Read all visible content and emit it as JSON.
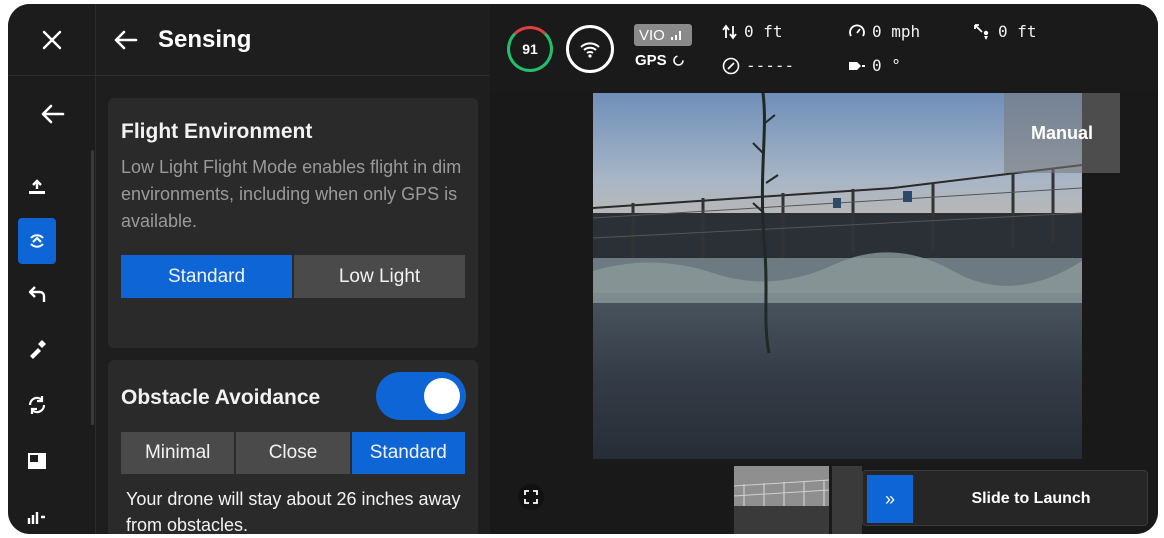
{
  "header": {
    "title": "Sensing"
  },
  "rail": {
    "items": [
      {
        "icon": "takeoff-icon"
      },
      {
        "icon": "sensing-icon",
        "active": true
      },
      {
        "icon": "return-icon"
      },
      {
        "icon": "flashlight-icon"
      },
      {
        "icon": "rotate-icon"
      },
      {
        "icon": "picture-in-picture-icon"
      },
      {
        "icon": "signal-icon"
      }
    ]
  },
  "flight_environment": {
    "title": "Flight Environment",
    "description": "Low Light Flight Mode enables flight in dim environments, including when only GPS is available.",
    "options": [
      "Standard",
      "Low Light"
    ],
    "selected": "Standard"
  },
  "obstacle_avoidance": {
    "title": "Obstacle Avoidance",
    "enabled": true,
    "options": [
      "Minimal",
      "Close",
      "Standard"
    ],
    "selected": "Standard",
    "note": "Your drone will stay about 26 inches away from obstacles."
  },
  "telemetry": {
    "battery": "91",
    "vio_label": "VIO",
    "gps_label": "GPS",
    "altitude": "0 ft",
    "speed": "0 mph",
    "distance": "0 ft",
    "heading": "-----",
    "gimbal": "0 °"
  },
  "camera": {
    "mode_badge": "Manual"
  },
  "launch": {
    "label": "Slide to Launch",
    "button_glyph": "»"
  },
  "colors": {
    "accent": "#0e66d6",
    "battery_ring": "#22c06a",
    "battery_low": "#e04040"
  }
}
